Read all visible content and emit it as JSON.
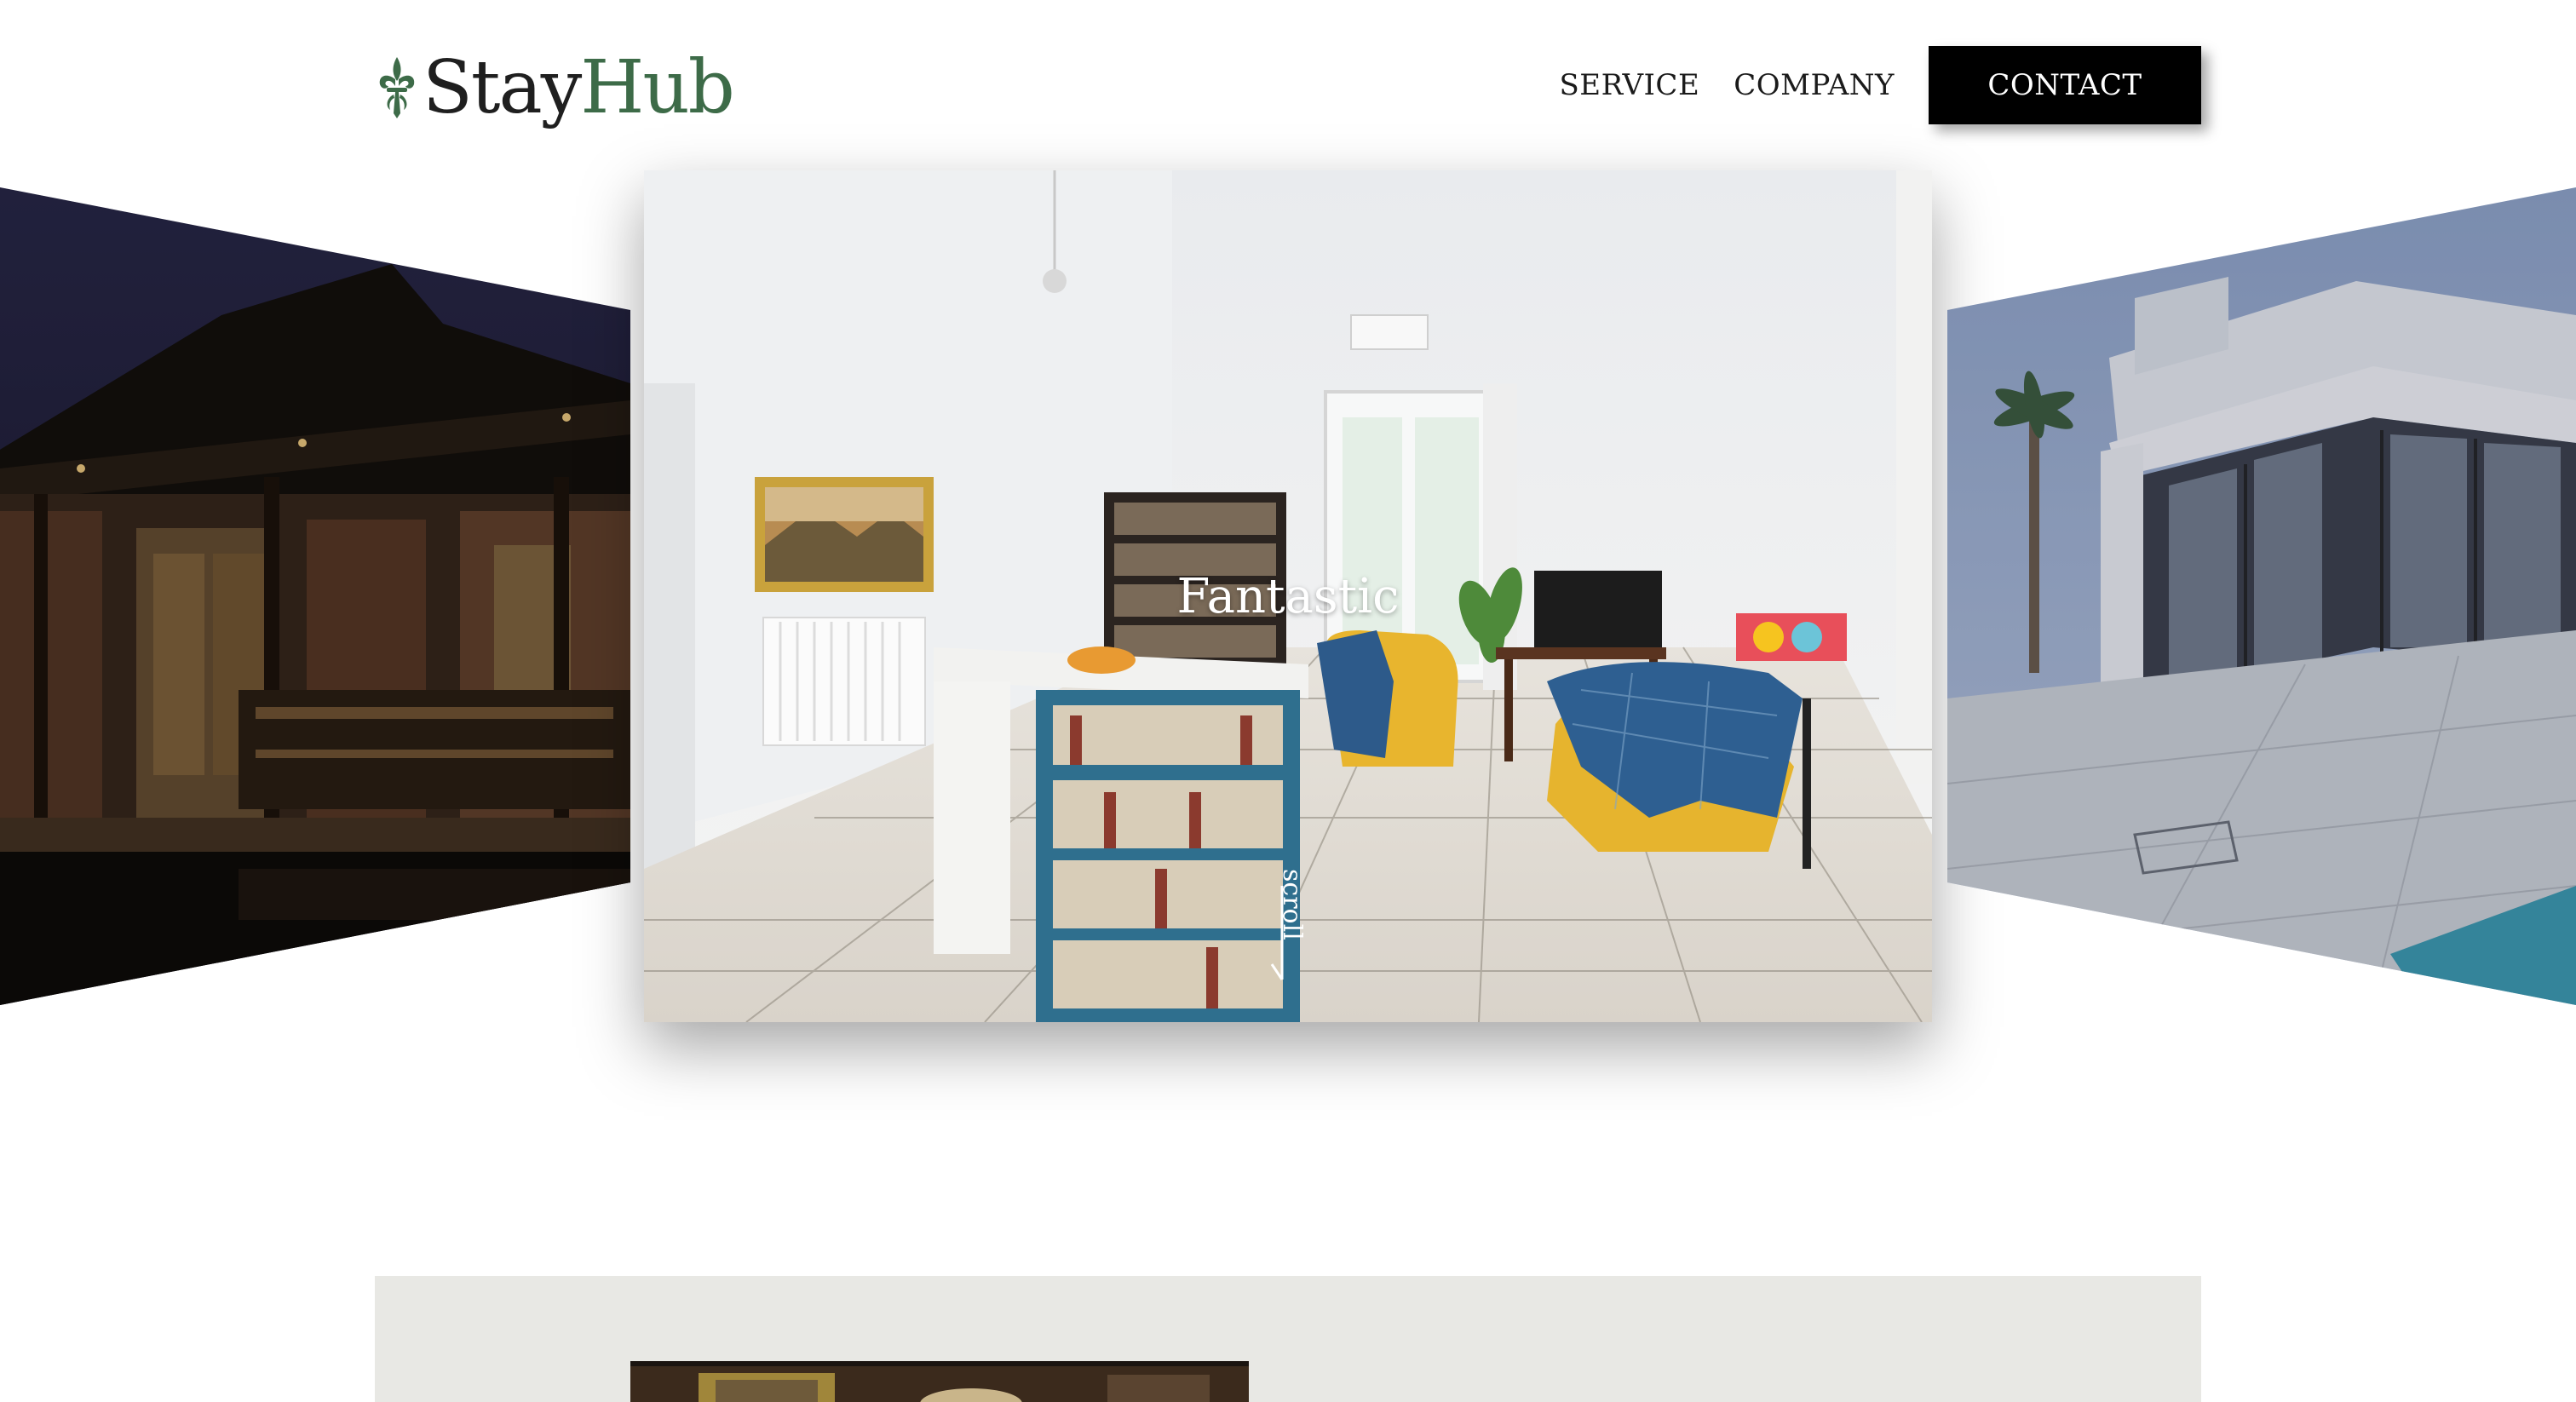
{
  "brand": {
    "name_part1": "Stay",
    "name_part2": "Hub",
    "icon": "fleur-de-lis-icon"
  },
  "nav": {
    "items": [
      {
        "label": "SERVICE"
      },
      {
        "label": "COMPANY"
      }
    ],
    "contact_label": "CONTACT"
  },
  "hero": {
    "slide_title": "Fantastic",
    "scroll_label": "scroll"
  },
  "colors": {
    "brand_green": "#3d6b48",
    "button_bg": "#000000",
    "section_bg": "#e8e8e4"
  }
}
